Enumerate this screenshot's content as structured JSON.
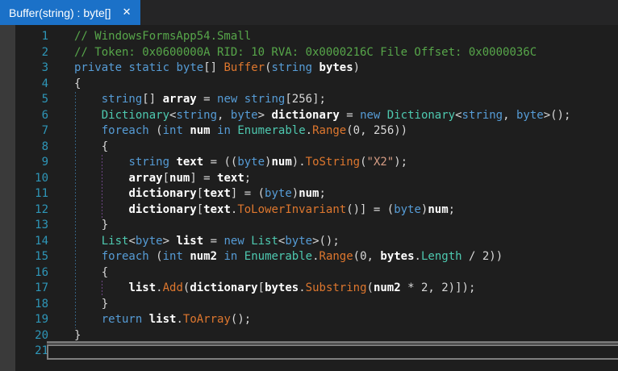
{
  "theme": {
    "tab_active_bg": "#1b71c8",
    "tabbar_bg": "#252526",
    "editor_bg": "#1e1e1e",
    "margin_strip_bg": "#3a3a3a",
    "line_number_color": "#2e96b8",
    "colors": {
      "plain": "#d8d8d8",
      "comment": "#57a64a",
      "kw": "#569cd6",
      "ty": "#4ec9b0",
      "m": "#de772e",
      "str": "#d69d85",
      "loc": "#ffffff",
      "guide_block": "#34607f",
      "guide_loop": "#6e4585"
    }
  },
  "tab": {
    "title": "Buffer(string) : byte[]",
    "close_icon": "✕"
  },
  "code": {
    "lines": [
      {
        "n": "1",
        "indent": 0,
        "tokens": [
          {
            "t": "// WindowsFormsApp54.Small",
            "c": "comment"
          }
        ]
      },
      {
        "n": "2",
        "indent": 0,
        "tokens": [
          {
            "t": "// Token: 0x0600000A RID: 10 RVA: 0x0000216C File Offset: 0x0000036C",
            "c": "comment"
          }
        ]
      },
      {
        "n": "3",
        "indent": 0,
        "tokens": [
          {
            "t": "private",
            "c": "kw"
          },
          {
            "t": " "
          },
          {
            "t": "static",
            "c": "kw"
          },
          {
            "t": " "
          },
          {
            "t": "byte",
            "c": "kw"
          },
          {
            "t": "[] "
          },
          {
            "t": "Buffer",
            "c": "m"
          },
          {
            "t": "("
          },
          {
            "t": "string",
            "c": "kw"
          },
          {
            "t": " "
          },
          {
            "t": "bytes",
            "c": "loc"
          },
          {
            "t": ")"
          }
        ]
      },
      {
        "n": "4",
        "indent": 0,
        "tokens": [
          {
            "t": "{"
          }
        ]
      },
      {
        "n": "5",
        "indent": 1,
        "tokens": [
          {
            "t": "string",
            "c": "kw"
          },
          {
            "t": "[] "
          },
          {
            "t": "array",
            "c": "loc"
          },
          {
            "t": " = "
          },
          {
            "t": "new",
            "c": "kw"
          },
          {
            "t": " "
          },
          {
            "t": "string",
            "c": "kw"
          },
          {
            "t": "[256];"
          }
        ]
      },
      {
        "n": "6",
        "indent": 1,
        "tokens": [
          {
            "t": "Dictionary",
            "c": "ty"
          },
          {
            "t": "<"
          },
          {
            "t": "string",
            "c": "kw"
          },
          {
            "t": ", "
          },
          {
            "t": "byte",
            "c": "kw"
          },
          {
            "t": "> "
          },
          {
            "t": "dictionary",
            "c": "loc"
          },
          {
            "t": " = "
          },
          {
            "t": "new",
            "c": "kw"
          },
          {
            "t": " "
          },
          {
            "t": "Dictionary",
            "c": "ty"
          },
          {
            "t": "<"
          },
          {
            "t": "string",
            "c": "kw"
          },
          {
            "t": ", "
          },
          {
            "t": "byte",
            "c": "kw"
          },
          {
            "t": ">();"
          }
        ]
      },
      {
        "n": "7",
        "indent": 1,
        "tokens": [
          {
            "t": "foreach",
            "c": "kw"
          },
          {
            "t": " ("
          },
          {
            "t": "int",
            "c": "kw"
          },
          {
            "t": " "
          },
          {
            "t": "num",
            "c": "loc"
          },
          {
            "t": " "
          },
          {
            "t": "in",
            "c": "kw"
          },
          {
            "t": " "
          },
          {
            "t": "Enumerable",
            "c": "ty"
          },
          {
            "t": "."
          },
          {
            "t": "Range",
            "c": "m"
          },
          {
            "t": "(0, 256))"
          }
        ]
      },
      {
        "n": "8",
        "indent": 1,
        "tokens": [
          {
            "t": "{"
          }
        ]
      },
      {
        "n": "9",
        "indent": 2,
        "tokens": [
          {
            "t": "string",
            "c": "kw"
          },
          {
            "t": " "
          },
          {
            "t": "text",
            "c": "loc"
          },
          {
            "t": " = (("
          },
          {
            "t": "byte",
            "c": "kw"
          },
          {
            "t": ")"
          },
          {
            "t": "num",
            "c": "loc"
          },
          {
            "t": ")."
          },
          {
            "t": "ToString",
            "c": "m"
          },
          {
            "t": "("
          },
          {
            "t": "\"X2\"",
            "c": "str"
          },
          {
            "t": ");"
          }
        ]
      },
      {
        "n": "10",
        "indent": 2,
        "tokens": [
          {
            "t": "array",
            "c": "loc"
          },
          {
            "t": "["
          },
          {
            "t": "num",
            "c": "loc"
          },
          {
            "t": "] = "
          },
          {
            "t": "text",
            "c": "loc"
          },
          {
            "t": ";"
          }
        ]
      },
      {
        "n": "11",
        "indent": 2,
        "tokens": [
          {
            "t": "dictionary",
            "c": "loc"
          },
          {
            "t": "["
          },
          {
            "t": "text",
            "c": "loc"
          },
          {
            "t": "] = ("
          },
          {
            "t": "byte",
            "c": "kw"
          },
          {
            "t": ")"
          },
          {
            "t": "num",
            "c": "loc"
          },
          {
            "t": ";"
          }
        ]
      },
      {
        "n": "12",
        "indent": 2,
        "tokens": [
          {
            "t": "dictionary",
            "c": "loc"
          },
          {
            "t": "["
          },
          {
            "t": "text",
            "c": "loc"
          },
          {
            "t": "."
          },
          {
            "t": "ToLowerInvariant",
            "c": "m"
          },
          {
            "t": "()] = ("
          },
          {
            "t": "byte",
            "c": "kw"
          },
          {
            "t": ")"
          },
          {
            "t": "num",
            "c": "loc"
          },
          {
            "t": ";"
          }
        ]
      },
      {
        "n": "13",
        "indent": 1,
        "tokens": [
          {
            "t": "}"
          }
        ]
      },
      {
        "n": "14",
        "indent": 1,
        "tokens": [
          {
            "t": "List",
            "c": "ty"
          },
          {
            "t": "<"
          },
          {
            "t": "byte",
            "c": "kw"
          },
          {
            "t": "> "
          },
          {
            "t": "list",
            "c": "loc"
          },
          {
            "t": " = "
          },
          {
            "t": "new",
            "c": "kw"
          },
          {
            "t": " "
          },
          {
            "t": "List",
            "c": "ty"
          },
          {
            "t": "<"
          },
          {
            "t": "byte",
            "c": "kw"
          },
          {
            "t": ">();"
          }
        ]
      },
      {
        "n": "15",
        "indent": 1,
        "tokens": [
          {
            "t": "foreach",
            "c": "kw"
          },
          {
            "t": " ("
          },
          {
            "t": "int",
            "c": "kw"
          },
          {
            "t": " "
          },
          {
            "t": "num2",
            "c": "loc"
          },
          {
            "t": " "
          },
          {
            "t": "in",
            "c": "kw"
          },
          {
            "t": " "
          },
          {
            "t": "Enumerable",
            "c": "ty"
          },
          {
            "t": "."
          },
          {
            "t": "Range",
            "c": "m"
          },
          {
            "t": "(0, "
          },
          {
            "t": "bytes",
            "c": "loc"
          },
          {
            "t": "."
          },
          {
            "t": "Length",
            "c": "ty"
          },
          {
            "t": " / 2))"
          }
        ]
      },
      {
        "n": "16",
        "indent": 1,
        "tokens": [
          {
            "t": "{"
          }
        ]
      },
      {
        "n": "17",
        "indent": 2,
        "tokens": [
          {
            "t": "list",
            "c": "loc"
          },
          {
            "t": "."
          },
          {
            "t": "Add",
            "c": "m"
          },
          {
            "t": "("
          },
          {
            "t": "dictionary",
            "c": "loc"
          },
          {
            "t": "["
          },
          {
            "t": "bytes",
            "c": "loc"
          },
          {
            "t": "."
          },
          {
            "t": "Substring",
            "c": "m"
          },
          {
            "t": "("
          },
          {
            "t": "num2",
            "c": "loc"
          },
          {
            "t": " * 2, 2)]);"
          }
        ]
      },
      {
        "n": "18",
        "indent": 1,
        "tokens": [
          {
            "t": "}"
          }
        ]
      },
      {
        "n": "19",
        "indent": 1,
        "tokens": [
          {
            "t": "return",
            "c": "kw"
          },
          {
            "t": " "
          },
          {
            "t": "list",
            "c": "loc"
          },
          {
            "t": "."
          },
          {
            "t": "ToArray",
            "c": "m"
          },
          {
            "t": "();"
          }
        ]
      },
      {
        "n": "20",
        "indent": 0,
        "tokens": [
          {
            "t": "}"
          }
        ]
      },
      {
        "n": "21",
        "indent": 0,
        "tokens": []
      }
    ],
    "guides": [
      {
        "kind": "block",
        "indent": 0,
        "from_line": 5,
        "to_line": 19
      },
      {
        "kind": "loop",
        "indent": 1,
        "from_line": 9,
        "to_line": 12
      },
      {
        "kind": "loop",
        "indent": 1,
        "from_line": 17,
        "to_line": 17
      }
    ],
    "current_line": 21
  }
}
